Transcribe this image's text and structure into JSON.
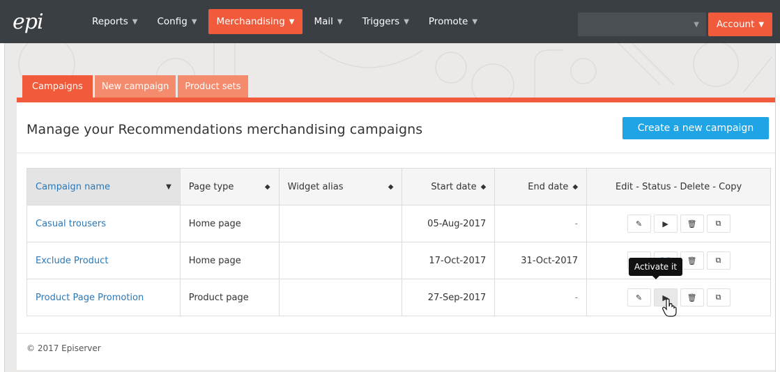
{
  "nav": {
    "logo": "epi",
    "items": [
      {
        "label": "Reports"
      },
      {
        "label": "Config"
      },
      {
        "label": "Merchandising"
      },
      {
        "label": "Mail"
      },
      {
        "label": "Triggers"
      },
      {
        "label": "Promote"
      }
    ],
    "account_label": "Account"
  },
  "tabs": [
    {
      "label": "Campaigns"
    },
    {
      "label": "New campaign"
    },
    {
      "label": "Product sets"
    }
  ],
  "page": {
    "title": "Manage your Recommendations merchandising campaigns",
    "create_button": "Create a new campaign"
  },
  "table": {
    "headers": {
      "name": "Campaign name",
      "page_type": "Page type",
      "widget_alias": "Widget alias",
      "start_date": "Start date",
      "end_date": "End date",
      "actions": "Edit - Status - Delete - Copy"
    },
    "rows": [
      {
        "name": "Casual trousers",
        "page_type": "Home page",
        "widget_alias": "",
        "start_date": "05-Aug-2017",
        "end_date": "-"
      },
      {
        "name": "Exclude Product",
        "page_type": "Home page",
        "widget_alias": "",
        "start_date": "17-Oct-2017",
        "end_date": "31-Oct-2017"
      },
      {
        "name": "Product Page Promotion",
        "page_type": "Product page",
        "widget_alias": "",
        "start_date": "27-Sep-2017",
        "end_date": "-"
      }
    ]
  },
  "tooltip": "Activate it",
  "footer": "© 2017 Episerver",
  "colors": {
    "nav_bg": "#3a3f44",
    "accent": "#f15a3a",
    "tab_inactive": "#f48b6d",
    "primary_button": "#1fa4e6",
    "link": "#2a77b8"
  }
}
